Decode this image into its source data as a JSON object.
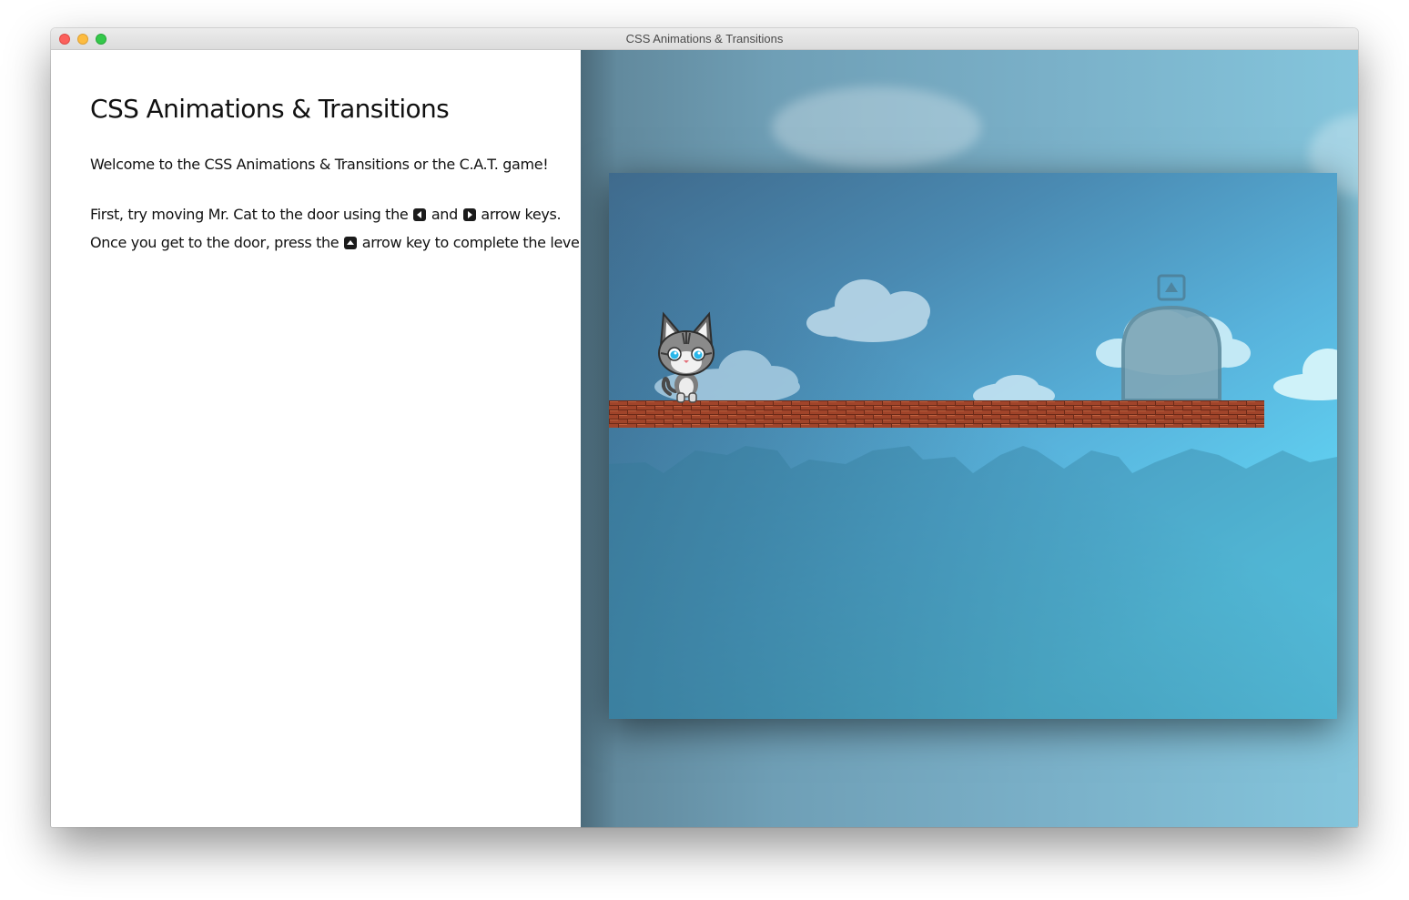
{
  "window": {
    "title": "CSS Animations & Transitions"
  },
  "instructions": {
    "heading": "CSS Animations & Transitions",
    "welcome": "Welcome to the CSS Animations & Transitions or the C.A.T. game!",
    "line1_part1": "First, try moving Mr. Cat to the door using the ",
    "line1_and": " and ",
    "line1_part2": " arrow keys.",
    "line2_part1": "Once you get to the door, press the ",
    "line2_part2": " arrow key to complete the level!"
  },
  "icons": {
    "left_key": "left-arrow-key-icon",
    "right_key": "right-arrow-key-icon",
    "up_key": "up-arrow-key-icon",
    "door_hint": "up-arrow-key-icon"
  },
  "colors": {
    "brick": "#a0442a",
    "brick_mortar": "#6a2a18",
    "door": "#7a9fae",
    "sky_dark": "#3f6a8c",
    "sky_light": "#66e0ff"
  }
}
